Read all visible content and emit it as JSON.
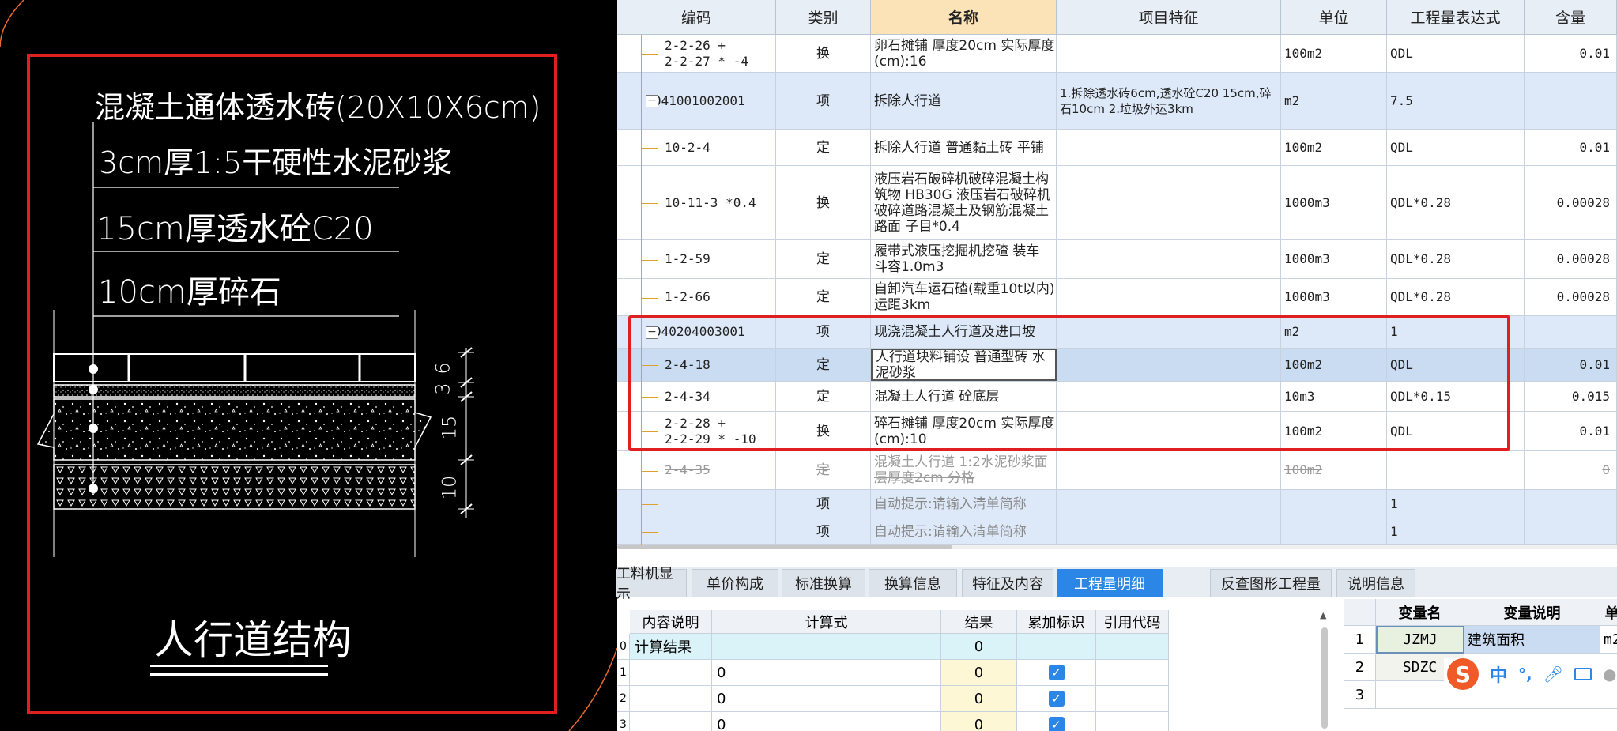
{
  "cad": {
    "title": "混凝土通体透水砖(20X10X6cm)",
    "layer1": "3cm厚1:5干硬性水泥砂浆",
    "layer2": "15cm厚透水砼C20",
    "layer3": "10cm厚碎石",
    "dim1": "3",
    "dim2": "6",
    "dim3": "15",
    "dim4": "10",
    "caption": "人行道结构",
    "highlight_color": "#e02020"
  },
  "grid": {
    "headers": [
      "编码",
      "类别",
      "名称",
      "项目特征",
      "单位",
      "工程量表达式",
      "含量"
    ],
    "rows": [
      {
        "code1": "2-2-26 +",
        "code2": "2-2-27 * -4",
        "type": "换",
        "name": "卵石摊铺 厚度20cm 实际厚度(cm):16",
        "feature": "",
        "unit": "100m2",
        "expr": "QDL",
        "qty": "0.01"
      },
      {
        "code1": "041001002001",
        "code2": "",
        "type": "项",
        "name": "拆除人行道",
        "feature": "1.拆除透水砖6cm,透水砼C20 15cm,碎石10cm 2.垃圾外运3km",
        "unit": "m2",
        "expr": "7.5",
        "qty": ""
      },
      {
        "code1": "10-2-4",
        "code2": "",
        "type": "定",
        "name": "拆除人行道 普通黏土砖 平铺",
        "feature": "",
        "unit": "100m2",
        "expr": "QDL",
        "qty": "0.01"
      },
      {
        "code1": "10-11-3 *0.4",
        "code2": "",
        "type": "换",
        "name": "液压岩石破碎机破碎混凝土构筑物 HB30G 液压岩石破碎机破碎道路混凝土及钢筋混凝土路面 子目*0.4",
        "feature": "",
        "unit": "1000m3",
        "expr": "QDL*0.28",
        "qty": "0.00028"
      },
      {
        "code1": "1-2-59",
        "code2": "",
        "type": "定",
        "name": "履带式液压挖掘机挖碴 装车 斗容1.0m3",
        "feature": "",
        "unit": "1000m3",
        "expr": "QDL*0.28",
        "qty": "0.00028"
      },
      {
        "code1": "1-2-66",
        "code2": "",
        "type": "定",
        "name": "自卸汽车运石碴(载重10t以内) 运距3km",
        "feature": "",
        "unit": "1000m3",
        "expr": "QDL*0.28",
        "qty": "0.00028"
      },
      {
        "code1": "040204003001",
        "code2": "",
        "type": "项",
        "name": "现浇混凝土人行道及进口坡",
        "feature": "",
        "unit": "m2",
        "expr": "1",
        "qty": ""
      },
      {
        "code1": "2-4-18",
        "code2": "",
        "type": "定",
        "name": "人行道块料铺设 普通型砖 水泥砂浆",
        "feature": "",
        "unit": "100m2",
        "expr": "QDL",
        "qty": "0.01"
      },
      {
        "code1": "2-4-34",
        "code2": "",
        "type": "定",
        "name": "混凝土人行道 砼底层",
        "feature": "",
        "unit": "10m3",
        "expr": "QDL*0.15",
        "qty": "0.015"
      },
      {
        "code1": "2-2-28 +",
        "code2": "2-2-29 * -10",
        "type": "换",
        "name": "碎石摊铺 厚度20cm 实际厚度(cm):10",
        "feature": "",
        "unit": "100m2",
        "expr": "QDL",
        "qty": "0.01"
      },
      {
        "code1": "2-4-35",
        "code2": "",
        "type": "定",
        "name": "混凝土人行道 1:2水泥砂浆面层厚度2cm 分格",
        "feature": "",
        "unit": "100m2",
        "expr": "",
        "qty": "0"
      },
      {
        "code1": "",
        "code2": "",
        "type": "项",
        "name": "自动提示:请输入清单简称",
        "feature": "",
        "unit": "",
        "expr": "1",
        "qty": ""
      },
      {
        "code1": "",
        "code2": "",
        "type": "项",
        "name": "自动提示:请输入清单简称",
        "feature": "",
        "unit": "",
        "expr": "1",
        "qty": ""
      }
    ]
  },
  "tabs": [
    "工料机显示",
    "单价构成",
    "标准换算",
    "换算信息",
    "特征及内容",
    "工程量明细",
    "反查图形工程量",
    "说明信息"
  ],
  "active_tab": "工程量明细",
  "detail": {
    "headers": [
      "内容说明",
      "计算式",
      "结果",
      "累加标识",
      "引用代码"
    ],
    "result_label": "计算结果",
    "result_value": "0",
    "rows": [
      {
        "idx": "0",
        "desc": "计算结果",
        "formula": "",
        "result": "0",
        "checked": false
      },
      {
        "idx": "1",
        "desc": "",
        "formula": "0",
        "result": "0",
        "checked": true
      },
      {
        "idx": "2",
        "desc": "",
        "formula": "0",
        "result": "0",
        "checked": true
      },
      {
        "idx": "3",
        "desc": "",
        "formula": "0",
        "result": "0",
        "checked": true
      }
    ]
  },
  "vars": {
    "headers": [
      "变量名",
      "变量说明",
      "单"
    ],
    "rows": [
      {
        "idx": "1",
        "name": "JZMJ",
        "desc": "建筑面积",
        "unit": "m2"
      },
      {
        "idx": "2",
        "name": "SDZC",
        "desc": "",
        "unit": ""
      },
      {
        "idx": "3",
        "name": "",
        "desc": "",
        "unit": ""
      }
    ]
  },
  "ime": {
    "logo": "S",
    "lang": "中",
    "punct": "°,"
  }
}
